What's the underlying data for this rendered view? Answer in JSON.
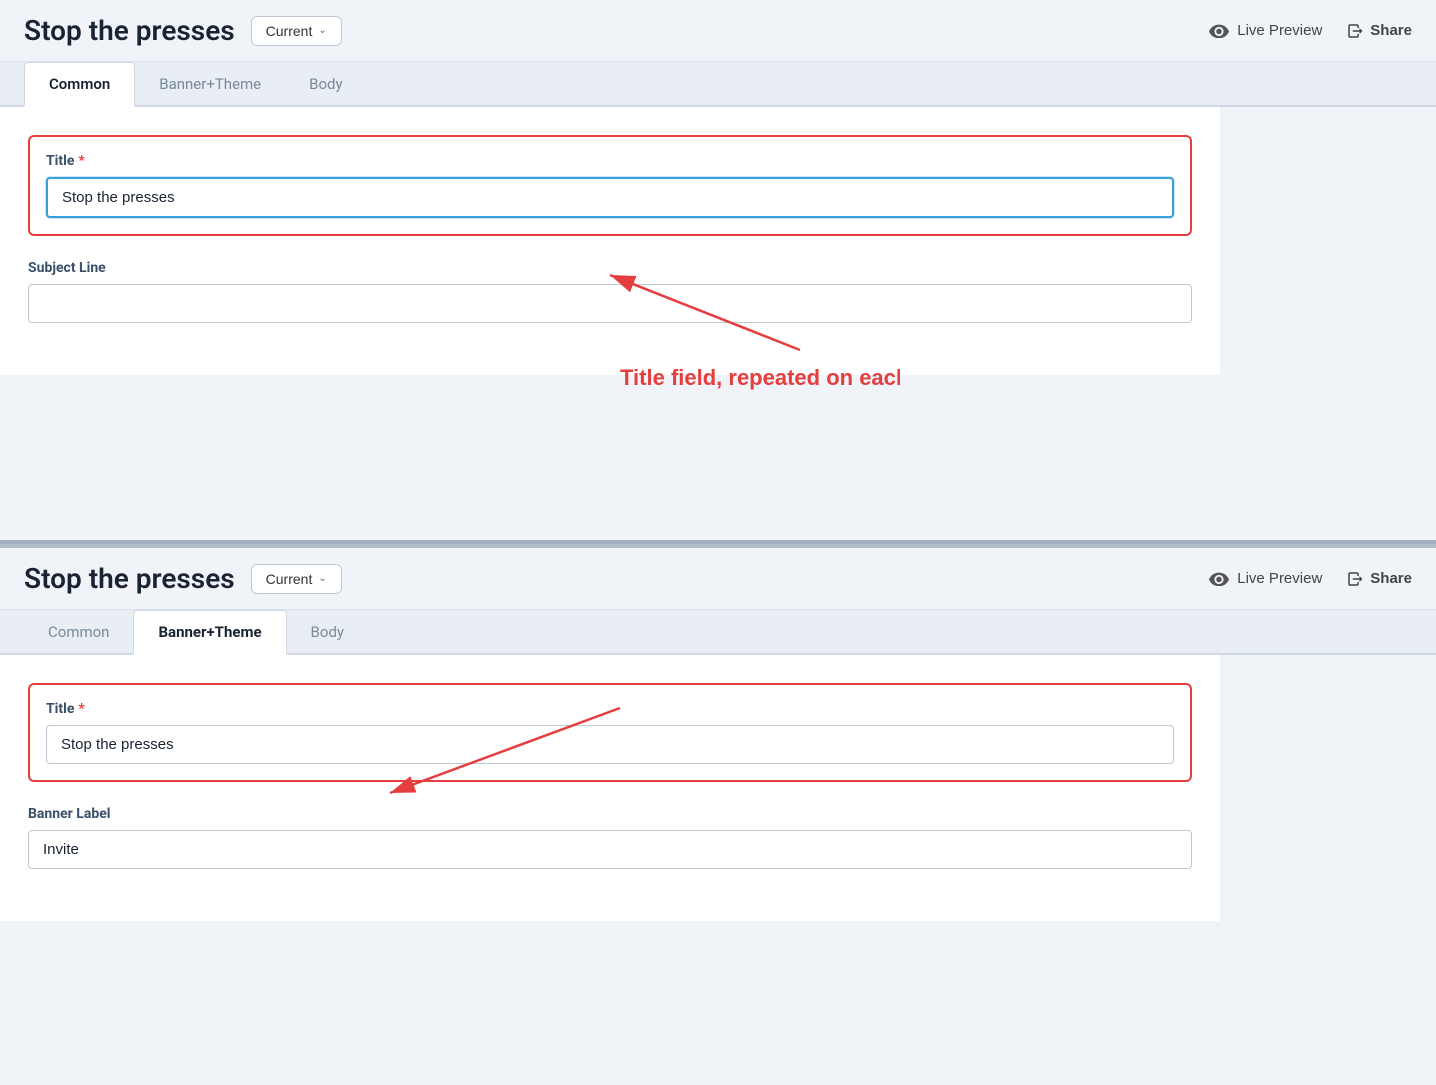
{
  "app": {
    "title": "Stop the presses"
  },
  "section_top": {
    "title": "Stop the presses",
    "version_label": "Current",
    "live_preview_label": "Live Preview",
    "share_label": "Share",
    "tabs": [
      {
        "id": "common",
        "label": "Common",
        "active": true
      },
      {
        "id": "banner_theme",
        "label": "Banner+Theme",
        "active": false
      },
      {
        "id": "body",
        "label": "Body",
        "active": false
      }
    ],
    "title_field": {
      "label": "Title",
      "required": true,
      "value": "Stop the presses",
      "placeholder": ""
    },
    "subject_line_field": {
      "label": "Subject Line",
      "required": false,
      "value": "",
      "placeholder": ""
    }
  },
  "section_bottom": {
    "title": "Stop the presses",
    "version_label": "Current",
    "live_preview_label": "Live Preview",
    "share_label": "Share",
    "tabs": [
      {
        "id": "common",
        "label": "Common",
        "active": false
      },
      {
        "id": "banner_theme",
        "label": "Banner+Theme",
        "active": true
      },
      {
        "id": "body",
        "label": "Body",
        "active": false
      }
    ],
    "title_field": {
      "label": "Title",
      "required": true,
      "value": "Stop the presses",
      "placeholder": ""
    },
    "banner_label_field": {
      "label": "Banner Label",
      "required": false,
      "value": "Invite",
      "placeholder": ""
    }
  },
  "annotation": {
    "text": "Title field, repeated on each tab"
  },
  "icons": {
    "eye": "👁",
    "share": "➦",
    "chevron_down": "∨"
  }
}
